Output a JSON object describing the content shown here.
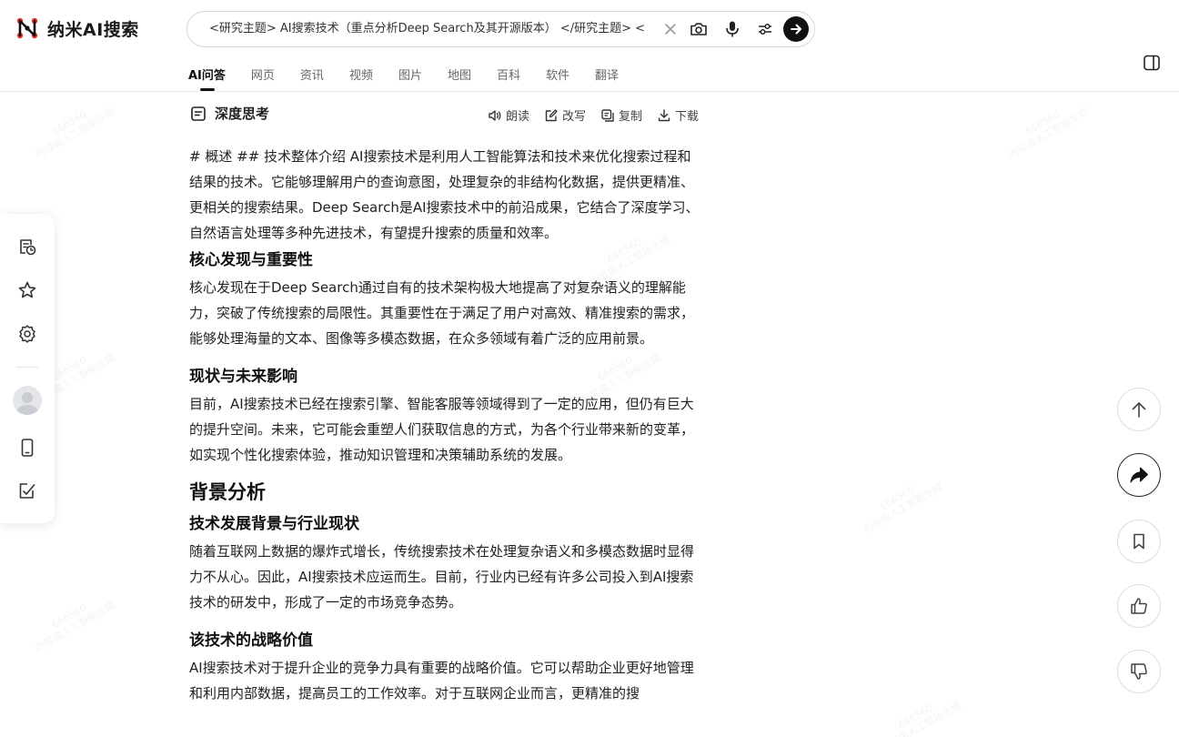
{
  "app": {
    "name": "纳米AI搜索"
  },
  "search": {
    "query": "<研究主题> AI搜索技术（重点分析Deep Search及其开源版本） </研究主题> <"
  },
  "tabs": [
    {
      "label": "AI问答"
    },
    {
      "label": "网页"
    },
    {
      "label": "资讯"
    },
    {
      "label": "视频"
    },
    {
      "label": "图片"
    },
    {
      "label": "地图"
    },
    {
      "label": "百科"
    },
    {
      "label": "软件"
    },
    {
      "label": "翻译"
    }
  ],
  "content_bar": {
    "title": "深度思考",
    "read": "朗读",
    "rewrite": "改写",
    "copy": "复制",
    "download": "下载"
  },
  "article": {
    "intro": "# 概述 ## 技术整体介绍 AI搜索技术是利用人工智能算法和技术来优化搜索过程和结果的技术。它能够理解用户的查询意图，处理复杂的非结构化数据，提供更精准、更相关的搜索结果。Deep Search是AI搜索技术中的前沿成果，它结合了深度学习、自然语言处理等多种先进技术，有望提升搜索的质量和效率。",
    "h_core": "核心发现与重要性",
    "p_core": "核心发现在于Deep Search通过自有的技术架构极大地提高了对复杂语义的理解能力，突破了传统搜索的局限性。其重要性在于满足了用户对高效、精准搜索的需求，能够处理海量的文本、图像等多模态数据，在众多领域有着广泛的应用前景。",
    "h_status": "现状与未来影响",
    "p_status": "目前，AI搜索技术已经在搜索引擎、智能客服等领域得到了一定的应用，但仍有巨大的提升空间。未来，它可能会重塑人们获取信息的方式，为各个行业带来新的变革，如实现个性化搜索体验，推动知识管理和决策辅助系统的发展。",
    "h_background": "背景分析",
    "h_industry": "技术发展背景与行业现状",
    "p_industry": "随着互联网上数据的爆炸式增长，传统搜索技术在处理复杂语义和多模态数据时显得力不从心。因此，AI搜索技术应运而生。目前，行业内已经有许多公司投入到AI搜索技术的研发中，形成了一定的市场竞争态势。",
    "h_strategic": "该技术的战略价值",
    "p_strategic": "AI搜索技术对于提升企业的竞争力具有重要的战略价值。它可以帮助企业更好地管理和利用内部数据，提高员工的工作效率。对于互联网企业而言，更精准的搜"
  },
  "watermark": {
    "line1": "666560",
    "line2": "内容由人工智能生成"
  },
  "icons": {
    "logo": "nano-logo-icon",
    "clear": "close-icon",
    "camera": "camera-icon",
    "mic": "microphone-icon",
    "filter": "sliders-icon",
    "submit": "arrow-right-icon",
    "sidebar": "sidebar-panel-icon",
    "history": "history-icon",
    "favorites": "star-icon",
    "settings": "gear-icon",
    "mobile": "phone-icon",
    "notes": "edit-note-icon",
    "scroll_top": "arrow-up-icon",
    "share": "share-icon",
    "bookmark": "bookmark-icon",
    "like": "thumbs-up-icon",
    "dislike": "thumbs-down-icon"
  },
  "colors": {
    "primary_text": "#222222",
    "logo_red": "#e8332a",
    "submit_bg": "#111111"
  }
}
